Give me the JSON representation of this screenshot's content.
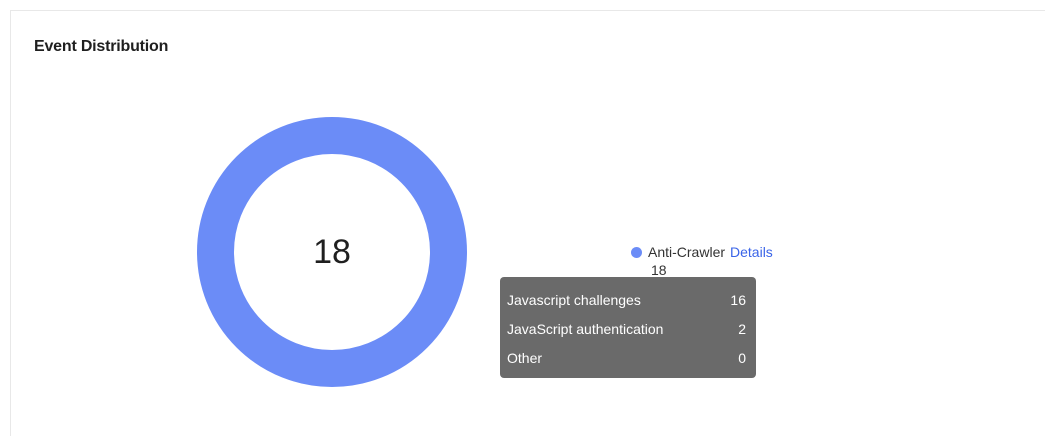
{
  "card": {
    "title": "Event Distribution"
  },
  "chart_data": {
    "type": "pie",
    "total": "18",
    "categories": [
      "Anti-Crawler"
    ],
    "values": [
      18
    ],
    "colors": [
      "#6b8cf7"
    ]
  },
  "legend": {
    "items": [
      {
        "label": "Anti-Crawler",
        "link": "Details",
        "count": "18",
        "color": "#6b8cf7"
      }
    ]
  },
  "tooltip": {
    "rows": [
      {
        "label": "Javascript challenges",
        "value": "16"
      },
      {
        "label": "JavaScript authentication",
        "value": "2"
      },
      {
        "label": "Other",
        "value": "0"
      }
    ]
  }
}
